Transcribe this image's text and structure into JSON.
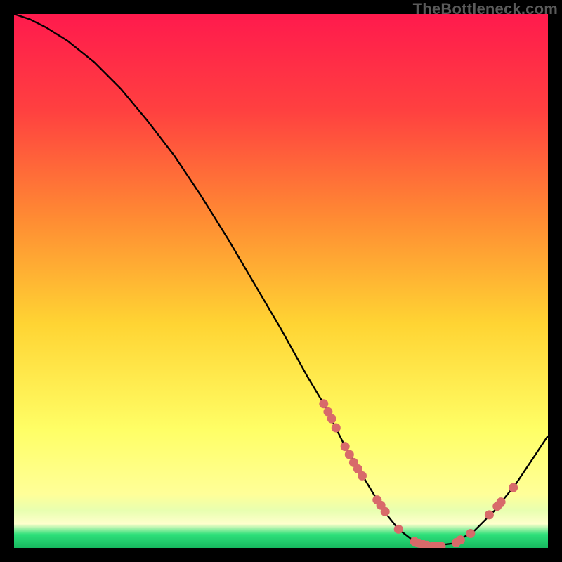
{
  "watermark": "TheBottleneck.com",
  "colors": {
    "bg_black": "#000000",
    "grad_top": "#ff1a4d",
    "grad_mid1": "#ff6a33",
    "grad_mid2": "#ffcc33",
    "grad_low": "#ffff66",
    "grad_band": "#ffff99",
    "grad_green": "#2de07a",
    "curve": "#000000",
    "dot": "#d86a6a"
  },
  "chart_data": {
    "type": "line",
    "title": "",
    "xlabel": "",
    "ylabel": "",
    "xlim": [
      0,
      100
    ],
    "ylim": [
      0,
      100
    ],
    "curve": {
      "name": "bottleneck-curve",
      "x": [
        0,
        3,
        6,
        10,
        15,
        20,
        25,
        30,
        35,
        40,
        45,
        50,
        55,
        58,
        60,
        62,
        65,
        68,
        70,
        72,
        75,
        78,
        82,
        86,
        90,
        94,
        98,
        100
      ],
      "y": [
        100,
        99,
        97.5,
        95,
        91,
        86,
        80,
        73.5,
        66,
        58,
        49.5,
        41,
        32,
        27,
        23,
        19,
        14,
        9,
        6,
        3.5,
        1.2,
        0.3,
        0.8,
        3,
        7,
        12,
        18,
        21
      ]
    },
    "dots": {
      "name": "data-points",
      "points": [
        {
          "x": 58.0,
          "y": 27.0
        },
        {
          "x": 58.8,
          "y": 25.5
        },
        {
          "x": 59.5,
          "y": 24.2
        },
        {
          "x": 60.3,
          "y": 22.5
        },
        {
          "x": 62.0,
          "y": 19.0
        },
        {
          "x": 62.8,
          "y": 17.5
        },
        {
          "x": 63.6,
          "y": 16.0
        },
        {
          "x": 64.4,
          "y": 14.8
        },
        {
          "x": 65.2,
          "y": 13.5
        },
        {
          "x": 68.0,
          "y": 9.0
        },
        {
          "x": 68.7,
          "y": 8.0
        },
        {
          "x": 69.5,
          "y": 6.8
        },
        {
          "x": 72.0,
          "y": 3.5
        },
        {
          "x": 75.0,
          "y": 1.2
        },
        {
          "x": 75.8,
          "y": 0.9
        },
        {
          "x": 76.5,
          "y": 0.7
        },
        {
          "x": 77.3,
          "y": 0.5
        },
        {
          "x": 78.5,
          "y": 0.3
        },
        {
          "x": 79.3,
          "y": 0.3
        },
        {
          "x": 80.0,
          "y": 0.3
        },
        {
          "x": 82.8,
          "y": 1.0
        },
        {
          "x": 83.6,
          "y": 1.5
        },
        {
          "x": 85.5,
          "y": 2.7
        },
        {
          "x": 89.0,
          "y": 6.2
        },
        {
          "x": 90.5,
          "y": 7.8
        },
        {
          "x": 91.2,
          "y": 8.6
        },
        {
          "x": 93.5,
          "y": 11.3
        }
      ]
    },
    "gradient_stops": [
      {
        "offset": 0.0,
        "color": "#ff1a4d"
      },
      {
        "offset": 0.18,
        "color": "#ff4040"
      },
      {
        "offset": 0.38,
        "color": "#ff8a33"
      },
      {
        "offset": 0.58,
        "color": "#ffd433"
      },
      {
        "offset": 0.78,
        "color": "#ffff66"
      },
      {
        "offset": 0.9,
        "color": "#ffff99"
      },
      {
        "offset": 0.93,
        "color": "#e8ffb0"
      },
      {
        "offset": 0.955,
        "color": "#ffffcc"
      },
      {
        "offset": 0.975,
        "color": "#2de07a"
      },
      {
        "offset": 1.0,
        "color": "#17b85f"
      }
    ]
  }
}
